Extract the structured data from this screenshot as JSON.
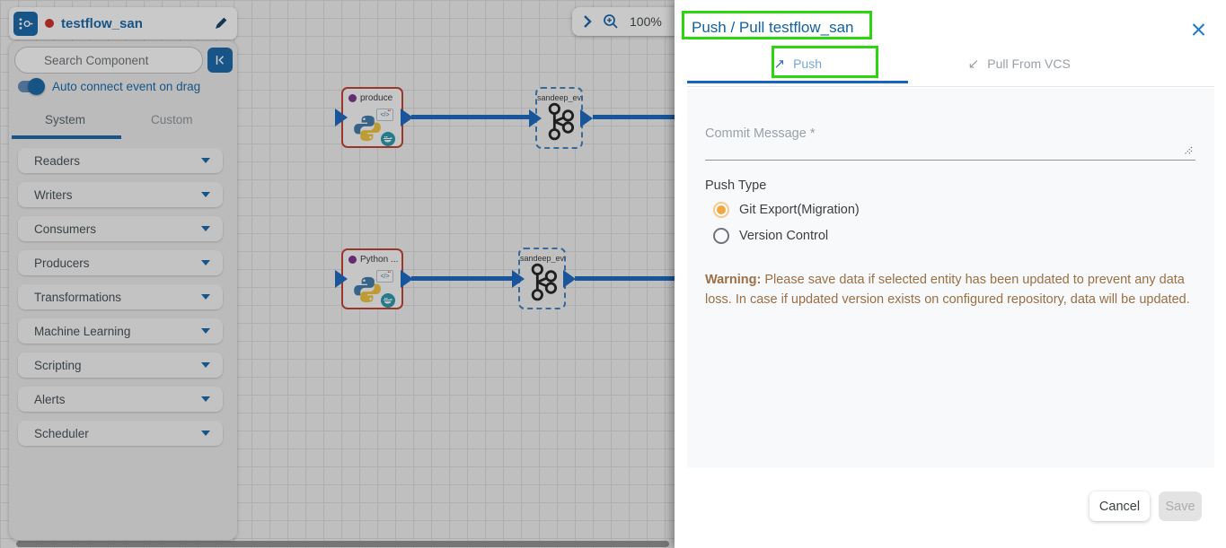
{
  "sidebar": {
    "title": "testflow_san",
    "search_placeholder": "Search Component",
    "toggle_label": "Auto connect event on drag",
    "tabs": {
      "system": "System",
      "custom": "Custom"
    },
    "categories": [
      "Readers",
      "Writers",
      "Consumers",
      "Producers",
      "Transformations",
      "Machine Learning",
      "Scripting",
      "Alerts",
      "Scheduler"
    ]
  },
  "canvas": {
    "zoom_level": "100%",
    "nodes": [
      {
        "label": "produce",
        "type": "python"
      },
      {
        "label": "sandeep_ev...",
        "type": "kafka"
      },
      {
        "label": "Python ...",
        "type": "python"
      },
      {
        "label": "sandeep_ev...",
        "type": "kafka"
      }
    ]
  },
  "modal": {
    "title": "Push / Pull testflow_san",
    "tabs": {
      "push": "Push",
      "pull": "Pull From VCS"
    },
    "push_arrow": "↗",
    "pull_arrow": "↙",
    "commit_placeholder": "Commit Message *",
    "push_type_label": "Push Type",
    "radios": [
      {
        "label": "Git Export(Migration)",
        "selected": true
      },
      {
        "label": "Version Control",
        "selected": false
      }
    ],
    "warning_prefix": "Warning:",
    "warning_text": " Please save data if selected entity has been updated to prevent any data loss. In case if updated version exists on configured repository, data will be updated.",
    "cancel_label": "Cancel",
    "save_label": "Save"
  },
  "colors": {
    "accent_blue": "#1265a8",
    "edge_blue": "#1565c0",
    "annotation_green": "#2bd60e",
    "warning_brown": "#9c6f44",
    "node_border_red": "#c23b2c",
    "radio_orange": "#f4a63f"
  }
}
